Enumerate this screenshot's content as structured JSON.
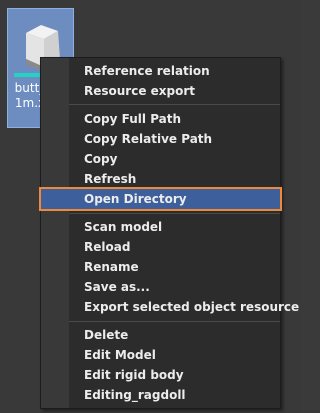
{
  "file": {
    "name": "butt_\n1m.x"
  },
  "menu": {
    "groups": [
      [
        "Reference relation",
        "Resource export"
      ],
      [
        "Copy Full Path",
        "Copy Relative Path",
        "Copy",
        "Refresh",
        "Open Directory"
      ],
      [
        "Scan model",
        "Reload",
        "Rename",
        "Save as...",
        "Export selected object resource"
      ],
      [
        "Delete",
        "Edit Model",
        "Edit rigid body",
        "Editing_ragdoll"
      ]
    ],
    "highlighted": "Open Directory"
  },
  "colors": {
    "menu_bg": "#2c2c2c",
    "highlight_bg": "#3d5f9c",
    "highlight_border": "#f08a38",
    "file_tile_bg": "#6d8dc0"
  }
}
